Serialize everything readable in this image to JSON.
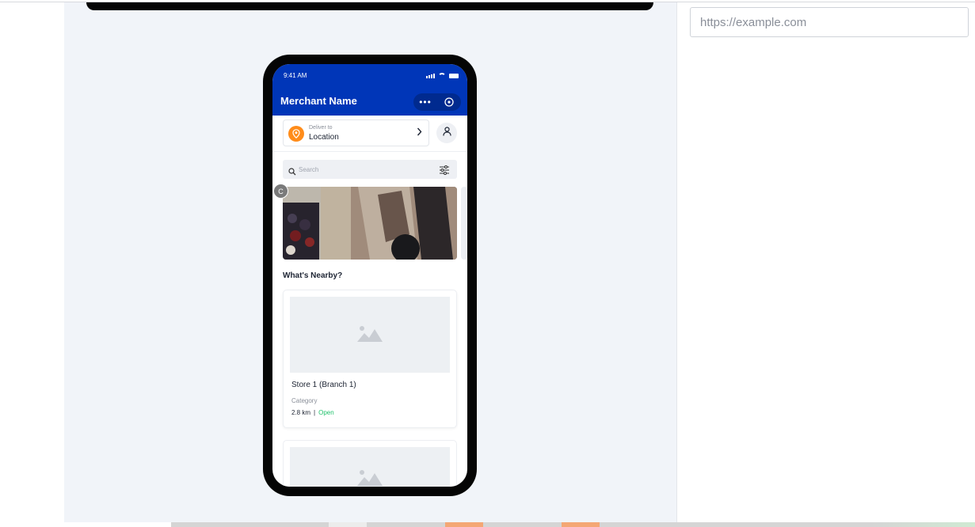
{
  "phone": {
    "status_time": "9:41 AM",
    "merchant_name": "Merchant Name",
    "deliver_label": "Deliver to",
    "location": "Location",
    "search_placeholder": "Search",
    "banner_badge": "C",
    "section_title": "What's Nearby?",
    "stores": [
      {
        "name": "Store 1 (Branch 1)",
        "category": "Category",
        "distance": "2.8 km",
        "separator": "|",
        "status": "Open"
      }
    ]
  },
  "sidebar": {
    "url_placeholder": "https://example.com"
  },
  "colors": {
    "brand": "#0036b8",
    "accent_orange": "#ff8c1a",
    "status_open": "#22c26d",
    "canvas_bg": "#f1f4f9"
  },
  "icons": [
    "more-icon",
    "close-circle-icon",
    "location-pin-icon",
    "chevron-right-icon",
    "user-icon",
    "search-icon",
    "filter-icon",
    "image-placeholder-icon"
  ]
}
